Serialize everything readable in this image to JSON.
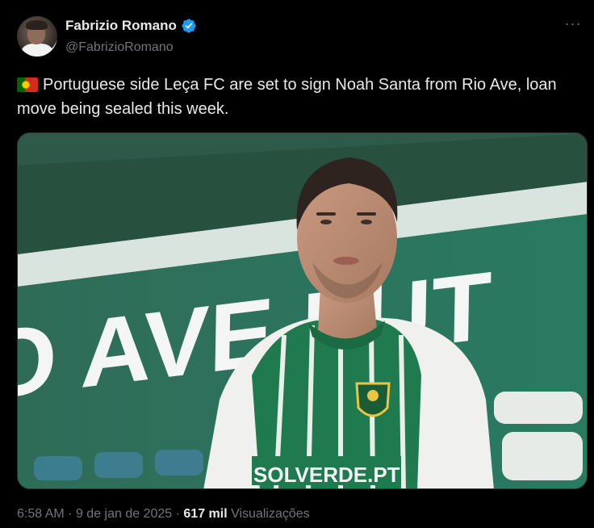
{
  "author": {
    "display_name": "Fabrizio Romano",
    "handle": "@FabrizioRomano",
    "verified_icon": "verified-badge-icon",
    "avatar_icon": "profile-photo"
  },
  "more_icon": "more-options-icon",
  "more_glyph": "···",
  "tweet": {
    "flag_icon": "portugal-flag-icon",
    "text": "Portuguese side Leça FC are set to sign Noah Santa from Rio Ave, loan move being sealed this week."
  },
  "media": {
    "image_subject": "football-player-photo",
    "stand_lettering": "O AVE FUT",
    "shirt_sponsor": "SOLVERDE.PT"
  },
  "metadata": {
    "time": "6:58 AM",
    "separator": "·",
    "date": "9 de jan de 2025",
    "views_count": "617 mil",
    "views_label": "Visualizações"
  },
  "colors": {
    "background": "#000000",
    "text_primary": "#e7e9ea",
    "text_secondary": "#71767b",
    "verified_blue": "#1d9bf0"
  }
}
